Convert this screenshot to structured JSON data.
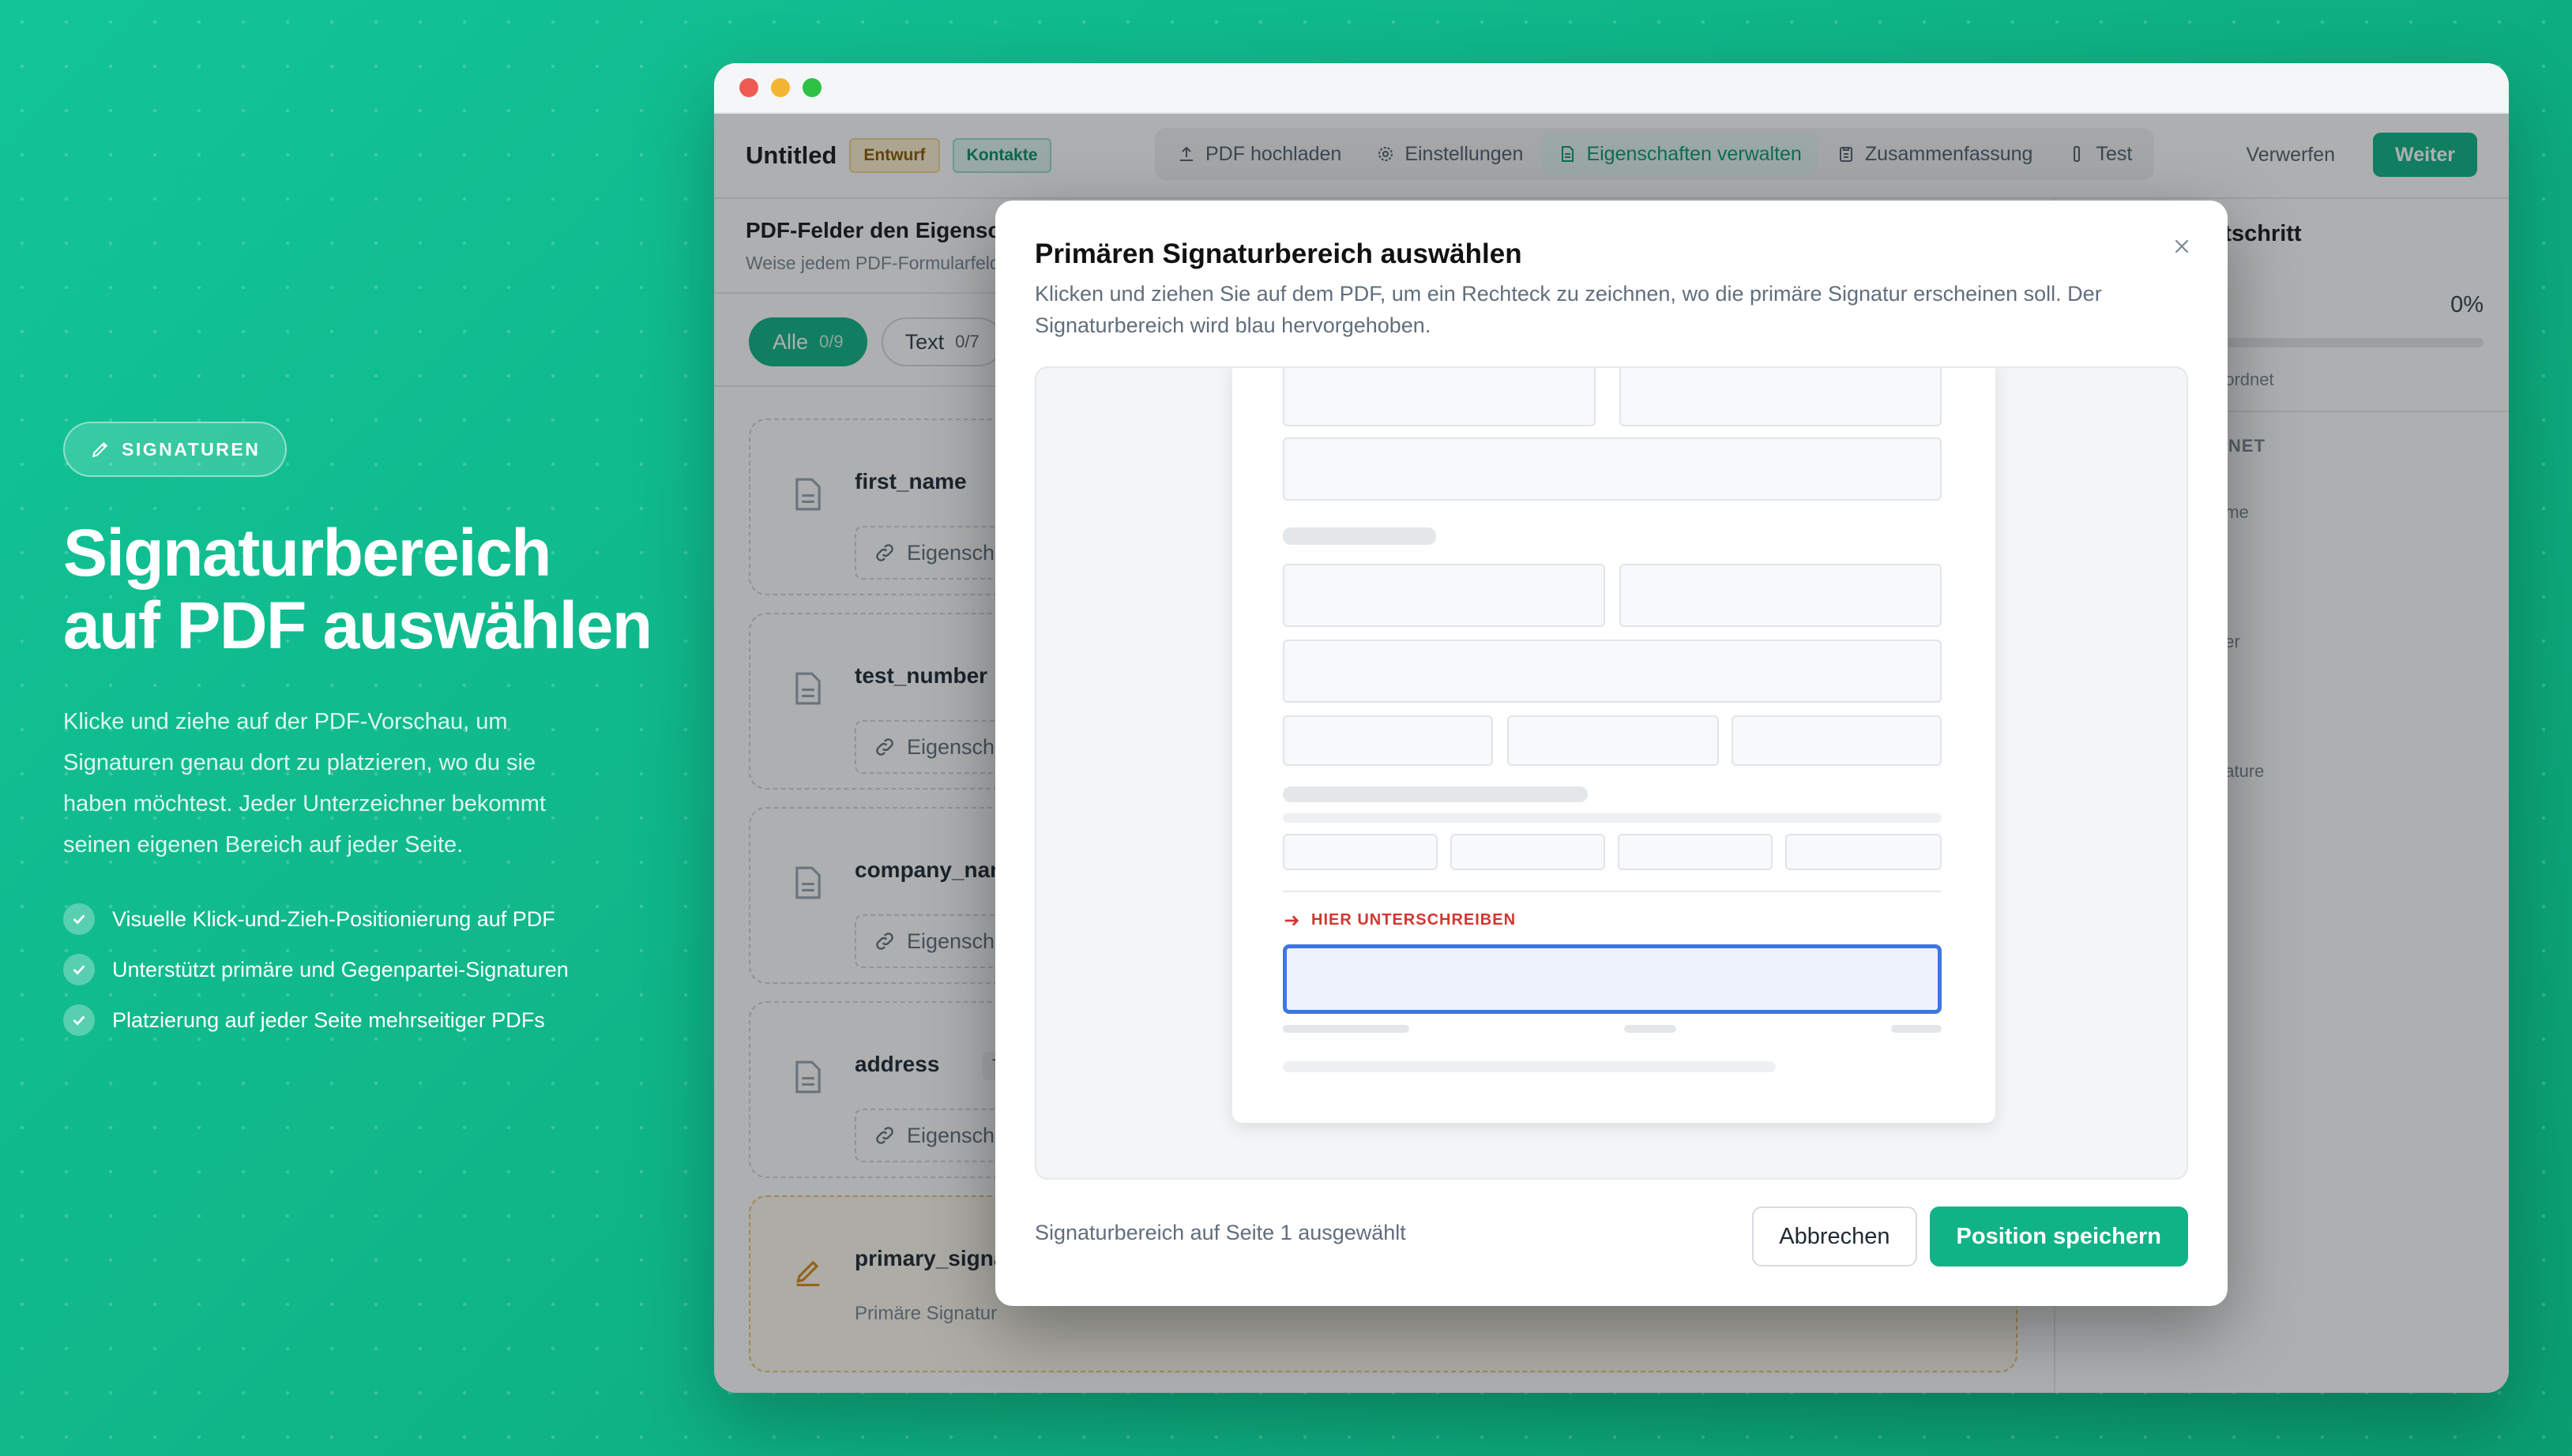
{
  "promo": {
    "badge": "SIGNATUREN",
    "title_line1": "Signaturbereich",
    "title_line2": "auf PDF auswählen",
    "description": "Klicke und ziehe auf der PDF-Vorschau, um Signaturen genau dort zu platzieren, wo du sie haben möchtest. Jeder Unterzeichner bekommt seinen eigenen Bereich auf jeder Seite.",
    "bullets": [
      "Visuelle Klick-und-Zieh-Positionierung auf PDF",
      "Unterstützt primäre und Gegenpartei-Signaturen",
      "Platzierung auf jeder Seite mehrseitiger PDFs"
    ]
  },
  "colors": {
    "brand_green": "#10b386",
    "signature_blue": "#3e76e0",
    "warning_red": "#d1362f",
    "draft_amber": "#fdf0cf"
  },
  "window": {
    "title": "Untitled",
    "tags": [
      "Entwurf",
      "Kontakte"
    ],
    "nav_tabs": [
      {
        "label": "PDF hochladen",
        "icon": "upload-icon"
      },
      {
        "label": "Einstellungen",
        "icon": "gear-icon"
      },
      {
        "label": "Eigenschaften verwalten",
        "icon": "document-icon",
        "active": true
      },
      {
        "label": "Zusammenfassung",
        "icon": "clipboard-icon"
      },
      {
        "label": "Test",
        "icon": "phone-icon"
      }
    ],
    "discard_label": "Verwerfen",
    "next_label": "Weiter"
  },
  "main": {
    "section_title": "PDF-Felder den Eigensch",
    "section_subtitle": "Weise jedem PDF-Formularfeld",
    "filters": [
      {
        "label": "Alle",
        "count": "0/9"
      },
      {
        "label": "Text",
        "count": "0/7"
      }
    ],
    "fields": [
      {
        "name": "first_name",
        "type": "Te",
        "link": "Eigenscha"
      },
      {
        "name": "test_number",
        "type": "",
        "link": "Eigenscha"
      },
      {
        "name": "company_nam",
        "type": "",
        "link": "Eigenscha"
      },
      {
        "name": "address",
        "type": "Text",
        "link": "Eigenscha"
      },
      {
        "name": "primary_signa",
        "type": "",
        "subtitle": "Primäre Signatur"
      }
    ]
  },
  "right_panel": {
    "title": "rtschritt",
    "percent": "0%",
    "assigned": "eordnet",
    "unassigned_header": "DNET",
    "items": [
      "ame",
      "ber",
      "nature"
    ]
  },
  "modal": {
    "title": "Primären Signaturbereich auswählen",
    "description": "Klicken und ziehen Sie auf dem PDF, um ein Rechteck zu zeichnen, wo die primäre Signatur erscheinen soll. Der Signaturbereich wird blau hervorgehoben.",
    "sign_here": "HIER UNTERSCHREIBEN",
    "status": "Signaturbereich auf Seite 1 ausgewählt",
    "cancel_label": "Abbrechen",
    "save_label": "Position speichern"
  }
}
